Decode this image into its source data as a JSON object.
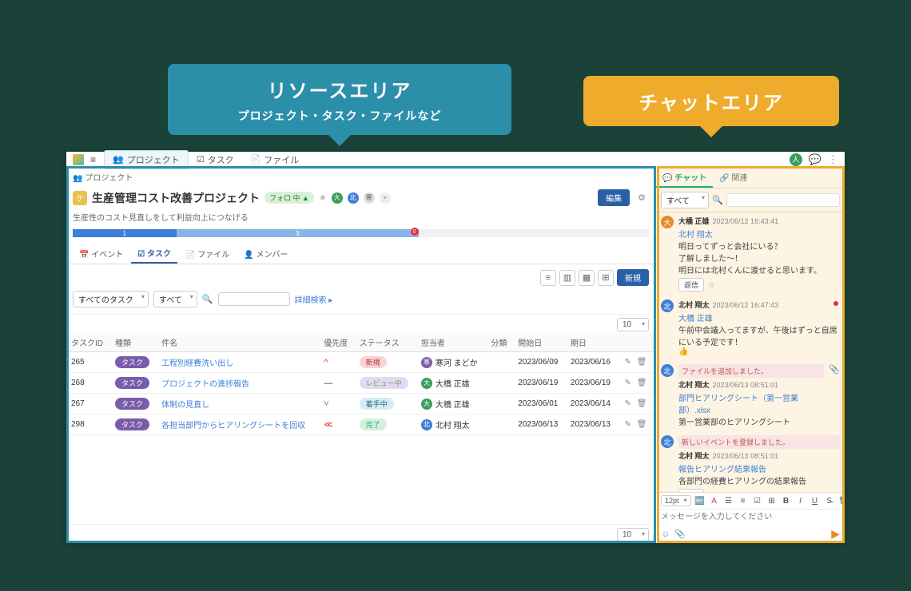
{
  "callouts": {
    "resource": {
      "title": "リソースエリア",
      "sub": "プロジェクト・タスク・ファイルなど"
    },
    "chat": {
      "title": "チャットエリア"
    }
  },
  "topnav": {
    "tabs": [
      {
        "icon": "👥",
        "label": "プロジェクト"
      },
      {
        "icon": "☑",
        "label": "タスク"
      },
      {
        "icon": "📄",
        "label": "ファイル"
      }
    ]
  },
  "breadcrumb": "👥 プロジェクト",
  "project": {
    "title": "生産管理コスト改善プロジェクト",
    "follow": "フォロ 中 ▲",
    "desc": "生産性のコスト見直しをして利益向上につなげる",
    "edit_btn": "編集",
    "progress": {
      "seg1": "1",
      "seg2": "3",
      "badge": "0"
    }
  },
  "innerTabs": [
    "📅 イベント",
    "☑ タスク",
    "📄 ファイル",
    "👤 メンバー"
  ],
  "filters": {
    "f1": "すべてのタスク",
    "f2": "すべて",
    "search_ph": "",
    "adv": "詳細検索 ▸"
  },
  "pageSize": "10",
  "newBtn": "新規",
  "table": {
    "headers": [
      "タスクID",
      "種類",
      "件名",
      "優先度",
      "ステータス",
      "担当者",
      "分類",
      "開始日",
      "期日",
      ""
    ],
    "rows": [
      {
        "id": "265",
        "kind": "タスク",
        "name": "工程別経費洗い出し",
        "pri": "^",
        "pri_cls": "pri-high",
        "st": "新規",
        "st_cls": "st-new",
        "av": "av-purple",
        "av_t": "寒",
        "assignee": "寒河 まどか",
        "cat": "",
        "start": "2023/06/09",
        "due": "2023/06/16"
      },
      {
        "id": "268",
        "kind": "タスク",
        "name": "プロジェクトの進捗報告",
        "pri": "—",
        "pri_cls": "",
        "st": "レビュー中",
        "st_cls": "st-rev",
        "av": "av-green",
        "av_t": "大",
        "assignee": "大橋 正雄",
        "cat": "",
        "start": "2023/06/19",
        "due": "2023/06/19"
      },
      {
        "id": "267",
        "kind": "タスク",
        "name": "体制の見直し",
        "pri": "˅",
        "pri_cls": "pri-low",
        "st": "着手中",
        "st_cls": "st-prog",
        "av": "av-green",
        "av_t": "大",
        "assignee": "大橋 正雄",
        "cat": "",
        "start": "2023/06/01",
        "due": "2023/06/14"
      },
      {
        "id": "298",
        "kind": "タスク",
        "name": "各担当部門からヒアリングシートを回収",
        "pri": "≪",
        "pri_cls": "pri-high",
        "st": "完了",
        "st_cls": "st-done",
        "av": "av-blue",
        "av_t": "北",
        "assignee": "北村 翔太",
        "cat": "",
        "start": "2023/06/13",
        "due": "2023/06/13"
      }
    ]
  },
  "chat": {
    "tabs": [
      "💬 チャット",
      "🔗 関連"
    ],
    "filter": "すべて",
    "messages": [
      {
        "av": "av-orange",
        "av_t": "大",
        "name": "大橋 正雄",
        "ts": "2023/06/12 16:43:41",
        "lines": [
          "了解しました～！",
          "明日には北村くんに渡せると思います。"
        ],
        "quote": "北村 翔太",
        "quote_line": "明日ってずっと会社にいる？",
        "reply": true,
        "dot": false
      },
      {
        "av": "av-blue",
        "av_t": "北",
        "name": "北村 翔太",
        "ts": "2023/06/12 16:47:43",
        "quote": "大橋 正雄",
        "lines": [
          "午前中会議入ってますが、午後はずっと自席にいる予定です！"
        ],
        "emoji": "👍",
        "dot": true
      },
      {
        "av": "av-blue",
        "av_t": "北",
        "filebox": "ファイルを追加しました。",
        "name": "北村 翔太",
        "ts": "2023/06/13 08:51:01",
        "file": "部門ヒアリングシート（第一営業部）.xlsx",
        "lines": [
          "第一営業部のヒアリングシート"
        ],
        "attach": true
      },
      {
        "av": "av-blue",
        "av_t": "北",
        "evtbox": "新しいイベントを登録しました。",
        "name": "北村 翔太",
        "ts": "2023/06/13 08:51:01",
        "link": "報告ヒアリング結果報告",
        "lines": [
          "各部門の経費ヒアリングの結果報告"
        ],
        "reply": true
      }
    ],
    "composer": {
      "size": "12pt",
      "placeholder": "メッセージを入力してください"
    }
  }
}
